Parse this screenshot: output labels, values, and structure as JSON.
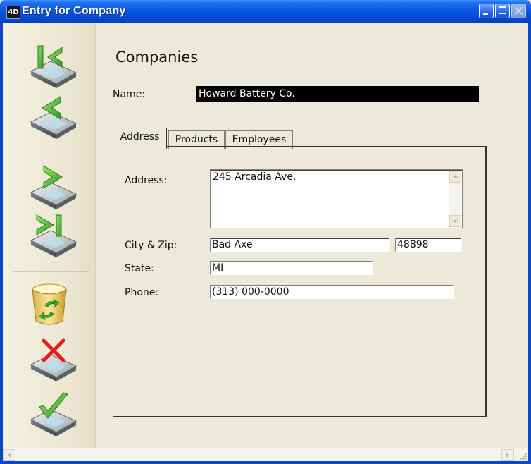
{
  "window": {
    "title": "Entry for Company",
    "app_icon_text": "4D",
    "controls": [
      "minimize-icon",
      "maximize-icon",
      "close-icon"
    ]
  },
  "toolbar": {
    "buttons": [
      {
        "name": "first-record",
        "icon": "first-record-icon"
      },
      {
        "name": "previous-record",
        "icon": "previous-record-icon"
      },
      {
        "name": "next-record",
        "icon": "next-record-icon"
      },
      {
        "name": "last-record",
        "icon": "last-record-icon"
      },
      {
        "name": "delete-record",
        "icon": "trash-refresh-icon"
      },
      {
        "name": "cancel",
        "icon": "cancel-x-icon"
      },
      {
        "name": "accept",
        "icon": "accept-check-icon"
      }
    ]
  },
  "form": {
    "title": "Companies",
    "name_label": "Name:",
    "name_value": "Howard Battery Co.",
    "tabs": [
      {
        "label": "Address",
        "active": true
      },
      {
        "label": "Products",
        "active": false
      },
      {
        "label": "Employees",
        "active": false
      }
    ],
    "address_label": "Address:",
    "address_value": "245 Arcadia Ave.",
    "city_zip_label": "City & Zip:",
    "city_value": "Bad Axe",
    "zip_value": "48898",
    "state_label": "State:",
    "state_value": "MI",
    "phone_label": "Phone:",
    "phone_value": "(313) 000-0000"
  },
  "colors": {
    "titlebar": "#0857e0",
    "window_bg": "#ece9d8",
    "selected_field_bg": "#000000",
    "nav_arrow_green": "#3fae2a",
    "cancel_red": "#e02020"
  }
}
